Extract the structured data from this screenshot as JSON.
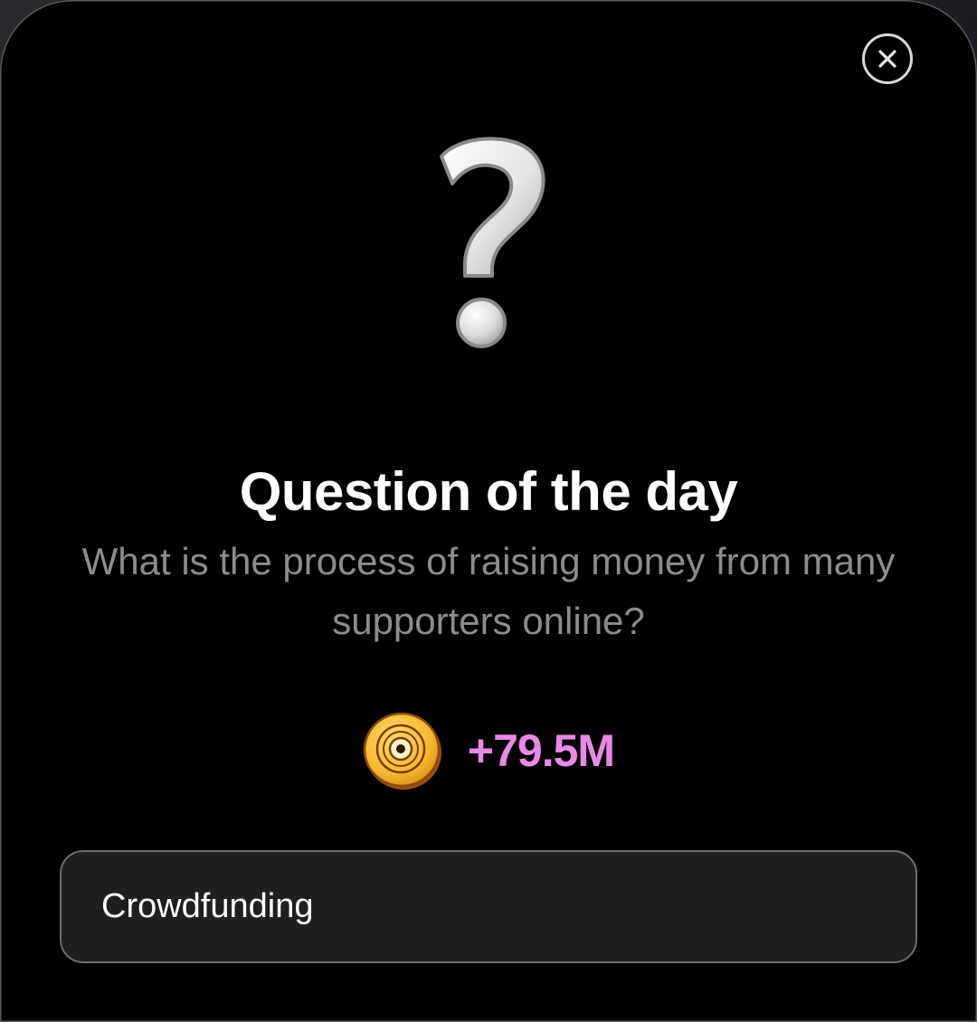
{
  "modal": {
    "title": "Question of the day",
    "question": "What is the process of raising money from many supporters online?",
    "header_icon": "question-mark-icon",
    "close_icon": "close-icon"
  },
  "reward": {
    "icon": "coin-icon",
    "amount": "+79.5M",
    "color": "#e98ae6"
  },
  "answer": {
    "value": "Crowdfunding",
    "placeholder": ""
  },
  "colors": {
    "background": "#000000",
    "title": "#ffffff",
    "question_text": "#8c8c8c",
    "field_background": "#1f1f1f",
    "field_border": "#6e6e6e",
    "coin": "#f5b82e"
  }
}
